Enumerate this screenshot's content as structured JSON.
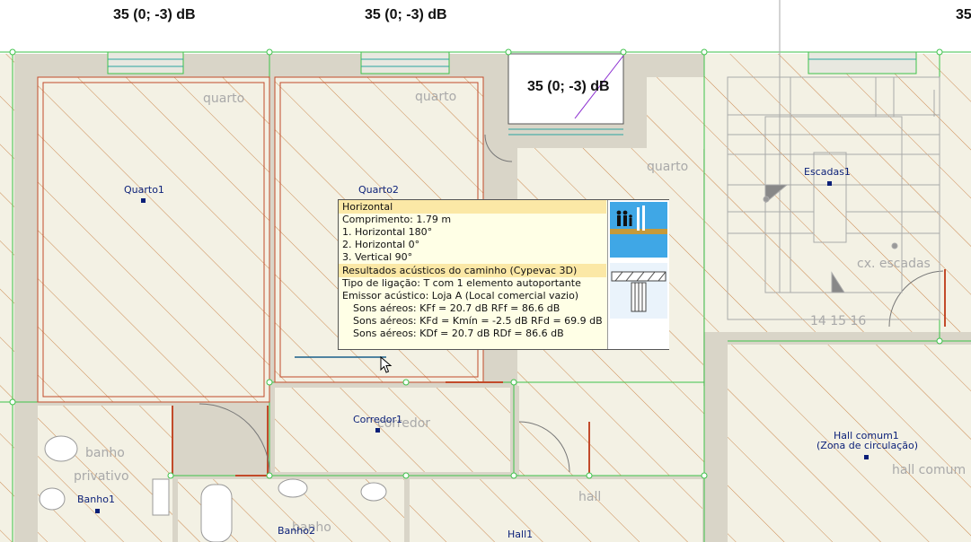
{
  "db_tags": [
    {
      "text": "35 (0; -3) dB"
    },
    {
      "text": "35 (0; -3) dB"
    },
    {
      "text": "35 (0; -3) dB"
    },
    {
      "text": "35"
    }
  ],
  "rooms": [
    {
      "name": "Quarto1",
      "label": "quarto"
    },
    {
      "name": "Quarto2",
      "label": "quarto"
    },
    {
      "name": "",
      "label": "quarto"
    },
    {
      "name": "Escadas1",
      "label": "cx. escadas"
    },
    {
      "name": "Corredor1",
      "label": "corredor"
    },
    {
      "name": "Banho1",
      "label_line1": "banho",
      "label_line2": "privativo"
    },
    {
      "name": "Banho2",
      "label": "banho"
    },
    {
      "name": "Hall1",
      "label": "hall"
    },
    {
      "name_line1": "Hall comum1",
      "name_line2": "(Zona de circulação)",
      "label": "hall comum"
    }
  ],
  "stair_numbers": "14 15 16",
  "tooltip": {
    "header": "Horizontal",
    "length": "Comprimento: 1.79 m",
    "path": [
      "1. Horizontal 180°",
      "2. Horizontal 0°",
      "3. Vertical 90°"
    ],
    "results_header": "Resultados acústicos do caminho (Cypevac 3D)",
    "junction": "Tipo de ligação: T com 1 elemento autoportante",
    "emitter": "Emissor acústico: Loja A (Local comercial vazio)",
    "airborne": [
      "Sons aéreos: KFf = 20.7 dB  RFf = 86.6 dB",
      "Sons aéreos: KFd = Kmín = -2.5 dB  RFd = 69.9 dB",
      "Sons aéreos: KDf = 20.7 dB  RDf = 86.6 dB"
    ],
    "people_icon": "people-icon",
    "section_icon": "wall-section-icon"
  },
  "colors": {
    "floor": "#f3f1e4",
    "wall": "#dcd8cb",
    "hatch": "#c97b3c",
    "grid_green": "#3ec24a",
    "tooltip_bg": "#ffffe6",
    "tooltip_header": "#fbe8a6",
    "room_name": "#0a1f78"
  }
}
